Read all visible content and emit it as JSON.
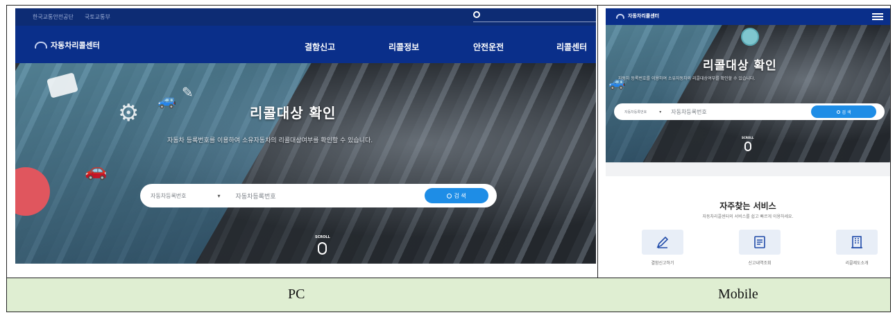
{
  "captions": {
    "pc": "PC",
    "mobile": "Mobile"
  },
  "pc": {
    "top_links": [
      "한국교통안전공단",
      "국토교통부"
    ],
    "brand": "자동차리콜센터",
    "nav": [
      "결함신고",
      "리콜정보",
      "안전운전",
      "리콜센터"
    ],
    "hero_title": "리콜대상 확인",
    "hero_subtitle": "자동차 등록번호를 이용하여 소유자동차의 리콜대상여부를 확인할 수 있습니다.",
    "search": {
      "select": "자동차등록번호",
      "placeholder": "자동차등록번호",
      "button": "검 색"
    },
    "scroll": "SCROLL"
  },
  "mobile": {
    "brand": "자동차리콜센터",
    "hero_title": "리콜대상 확인",
    "hero_subtitle": "자동차 등록번호를 이용하여 소유자동차의 리콜대상여부를 확인할 수 있습니다.",
    "search": {
      "select": "자동차등록번호",
      "placeholder": "자동차등록번호",
      "button": "검 색"
    },
    "scroll": "SCROLL",
    "services_title": "자주찾는 서비스",
    "services_subtitle": "자동차리콜센터의 서비스를 쉽고 빠르게 이용하세요.",
    "services": [
      {
        "label": "결함신고하기",
        "icon": "pencil-icon"
      },
      {
        "label": "신고내역조회",
        "icon": "document-icon"
      },
      {
        "label": "리콜제도소개",
        "icon": "building-icon"
      }
    ]
  },
  "colors": {
    "nav_blue": "#0a2f8a",
    "accent": "#1e8de6",
    "caption_bg": "#dfeed2"
  }
}
